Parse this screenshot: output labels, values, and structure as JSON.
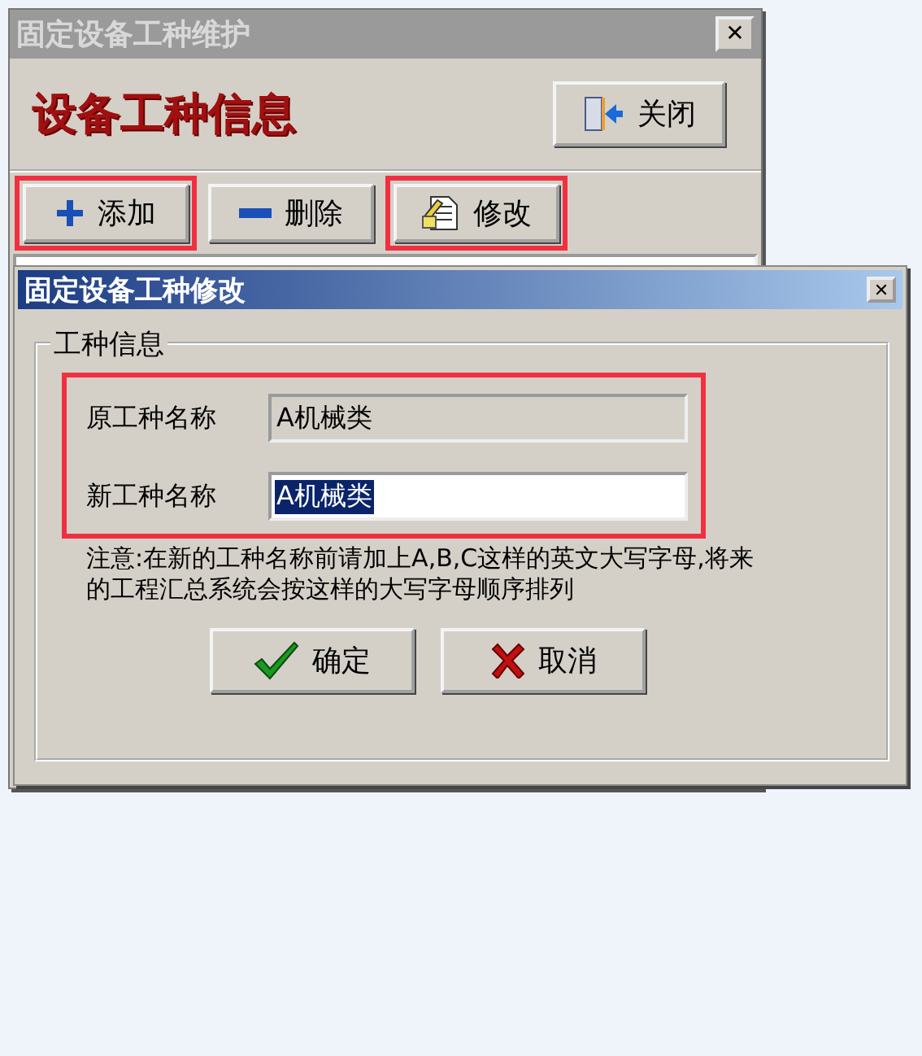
{
  "main_window": {
    "title": "固定设备工种维护",
    "close_button": "✕",
    "heading": "设备工种信息",
    "header_button": {
      "label": "关闭",
      "kind": "door"
    },
    "toolbar": [
      {
        "label": "添加",
        "kind": "plus",
        "highlighted": true
      },
      {
        "label": "删除",
        "kind": "minus",
        "highlighted": false
      },
      {
        "label": "修改",
        "kind": "edit",
        "highlighted": true
      }
    ]
  },
  "dialog": {
    "title": "固定设备工种修改",
    "close_button": "✕",
    "group_title": "工种信息",
    "fields_highlighted": true,
    "fields": [
      {
        "label": "原工种名称",
        "value": "A机械类",
        "disabled": true,
        "selected": false
      },
      {
        "label": "新工种名称",
        "value": "A机械类",
        "disabled": false,
        "selected": true
      }
    ],
    "note": "注意:在新的工种名称前请加上A,B,C这样的英文大写字母,将来的工程汇总系统会按这样的大写字母顺序排列",
    "buttons": [
      {
        "label": "确定",
        "kind": "check"
      },
      {
        "label": "取消",
        "kind": "cross"
      }
    ]
  }
}
